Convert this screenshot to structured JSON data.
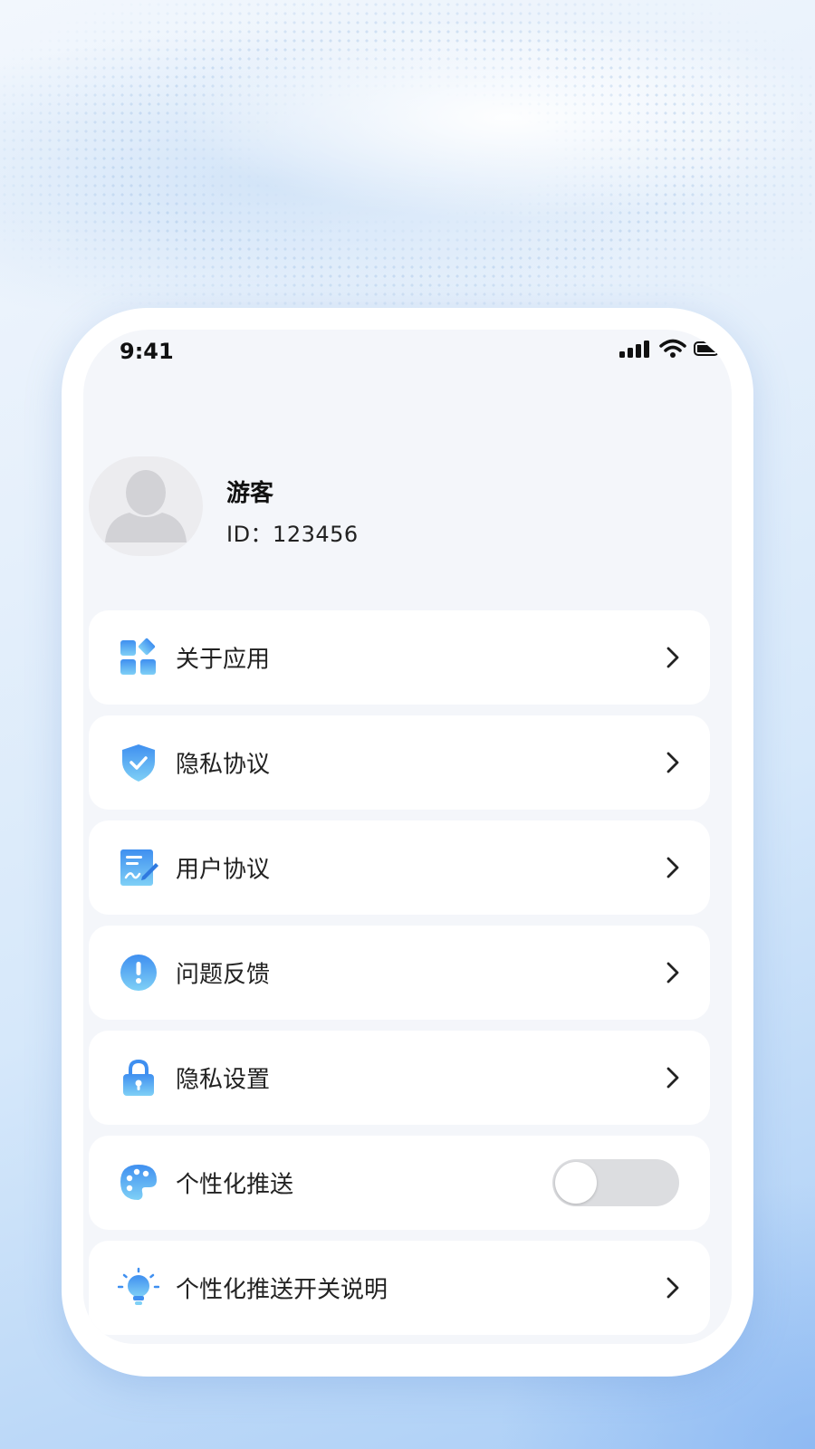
{
  "status_bar": {
    "time": "9:41"
  },
  "profile": {
    "name": "游客",
    "id": "ID：123456"
  },
  "menu": [
    {
      "label": "关于应用",
      "icon": "apps-icon"
    },
    {
      "label": "隐私协议",
      "icon": "shield-check-icon"
    },
    {
      "label": "用户协议",
      "icon": "document-sign-icon"
    },
    {
      "label": "问题反馈",
      "icon": "exclamation-icon"
    },
    {
      "label": "隐私设置",
      "icon": "lock-icon"
    },
    {
      "label": "个性化推送",
      "icon": "palette-icon",
      "toggle_on": false
    },
    {
      "label": "个性化推送开关说明",
      "icon": "lightbulb-icon"
    }
  ],
  "colors": {
    "accent": "#3f8ff0",
    "accent_light": "#7fd0f6"
  }
}
